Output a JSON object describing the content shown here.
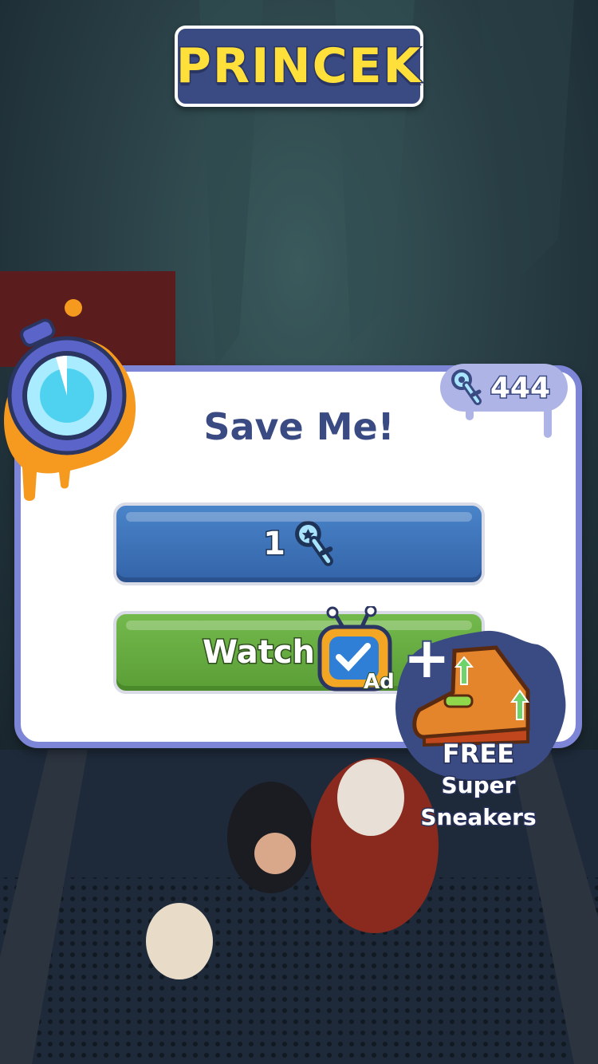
{
  "player": {
    "name": "PRINCEK"
  },
  "panel": {
    "title": "Save Me!",
    "key_balance": "444",
    "key_button": {
      "cost": "1",
      "icon": "key-icon"
    },
    "ad_button": {
      "label": "Watch",
      "ad_tag": "Ad",
      "plus": "+",
      "icon": "tv-ad-icon"
    },
    "bonus": {
      "free": "FREE",
      "line1": "Super",
      "line2": "Sneakers",
      "icon": "super-sneaker-icon"
    }
  },
  "colors": {
    "panel_border": "#7d86d6",
    "title": "#3a4a82",
    "key_button": "#3f73b8",
    "ad_button": "#66ad41",
    "player_name": "#ffe03a",
    "timer_splat": "#f59a1e"
  }
}
